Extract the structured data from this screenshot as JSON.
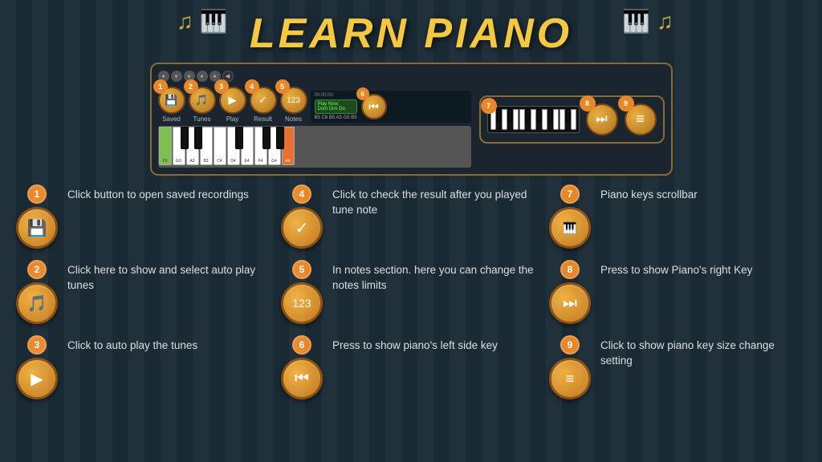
{
  "title": "LEARN PIANO",
  "topPanel": {
    "buttons": [
      {
        "num": "1",
        "icon": "💾",
        "label": "Saved"
      },
      {
        "num": "2",
        "icon": "🎵",
        "label": "Tunes"
      },
      {
        "num": "3",
        "icon": "▶",
        "label": "Play"
      },
      {
        "num": "4",
        "icon": "✓",
        "label": "Result"
      },
      {
        "num": "5",
        "icon": "123",
        "label": "Notes"
      }
    ],
    "rightButtons": [
      {
        "num": "6",
        "icon": "⏮",
        "isLeft": true
      },
      {
        "num": "7",
        "label": "scrollbar"
      },
      {
        "num": "8",
        "icon": "⏭"
      },
      {
        "num": "9",
        "icon": "≡"
      }
    ]
  },
  "instructions": {
    "left": [
      {
        "num": "1",
        "icon": "💾",
        "text": "Click button to open saved recordings"
      },
      {
        "num": "2",
        "icon": "🎵",
        "text": "Click here to show and select  auto play tunes"
      },
      {
        "num": "3",
        "icon": "▶",
        "text": "Click to auto play the tunes"
      }
    ],
    "center": [
      {
        "num": "4",
        "icon": "✓",
        "text": "Click to check the result after you played tune note"
      },
      {
        "num": "5",
        "icon": "123",
        "text": "In notes section. here you can change the notes limits"
      },
      {
        "num": "6",
        "icon": "⏮",
        "text": "Press to show piano's left side key"
      }
    ],
    "right": [
      {
        "num": "7",
        "icon": "🎹",
        "text": "Piano keys scrollbar"
      },
      {
        "num": "8",
        "icon": "⏭",
        "text": "Press to show Piano's right Key"
      },
      {
        "num": "9",
        "icon": "≡",
        "text": "Click to show  piano key size change setting"
      }
    ]
  },
  "piano": {
    "playNow": "Play Now:",
    "song": "Dum Dim Do",
    "notes": "B5 C6 B5 A5 G5 B5",
    "keys": [
      "F3",
      "G3",
      "A3",
      "B3",
      "C4",
      "D4",
      "E4",
      "F4",
      "G4",
      "A4"
    ]
  }
}
